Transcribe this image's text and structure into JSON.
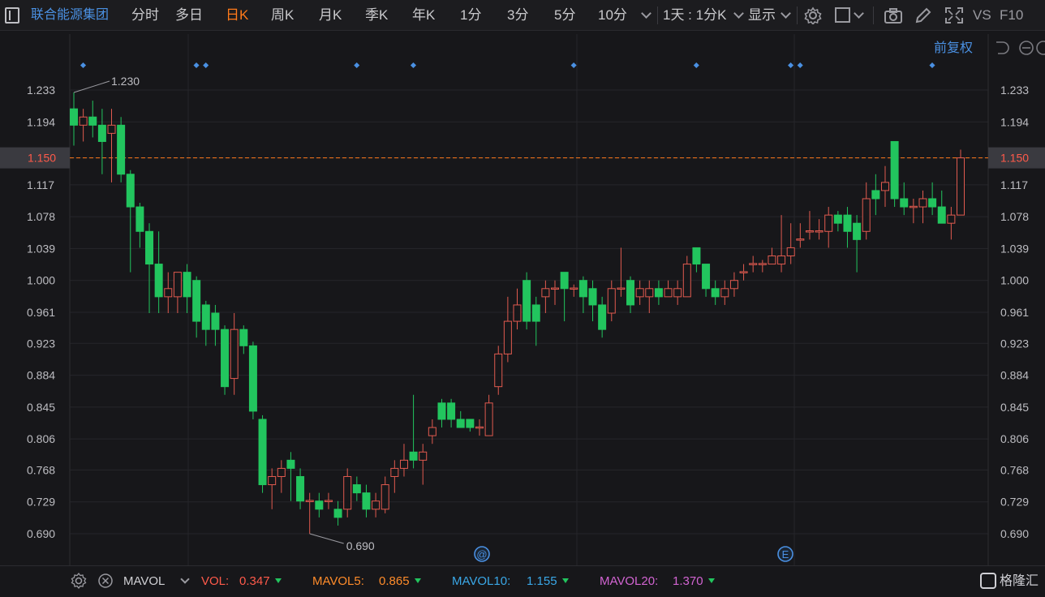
{
  "toolbar": {
    "stock_name": "联合能源集团",
    "periods": [
      "分时",
      "多日",
      "日K",
      "周K",
      "月K",
      "季K",
      "年K",
      "1分",
      "3分",
      "5分",
      "10分"
    ],
    "active_period": "日K",
    "interval_label": "1天 : 1分K",
    "display_label": "显示",
    "vs_label": "VS",
    "f10_label": "F10"
  },
  "chart_header": {
    "adjust_label": "前复权"
  },
  "current_price_label": "1.150",
  "colors": {
    "up": "#e05a4f",
    "down": "#22c55e",
    "accent_orange": "#ff7a1a",
    "link_blue": "#4a90e2"
  },
  "chart_data": {
    "type": "candlestick",
    "ylim": [
      0.67,
      1.26
    ],
    "y_ticks": [
      "1.233",
      "1.194",
      "1.150",
      "1.117",
      "1.078",
      "1.039",
      "1.000",
      "0.961",
      "0.923",
      "0.884",
      "0.845",
      "0.806",
      "0.768",
      "0.729",
      "0.690"
    ],
    "current_price": 1.15,
    "max_label": "1.230",
    "min_label": "0.690",
    "event_markers": [
      "@",
      "E"
    ],
    "candles": [
      [
        1.21,
        1.19,
        1.23,
        1.165
      ],
      [
        1.19,
        1.2,
        1.21,
        1.17
      ],
      [
        1.2,
        1.19,
        1.22,
        1.175
      ],
      [
        1.19,
        1.17,
        1.21,
        1.13
      ],
      [
        1.18,
        1.19,
        1.21,
        1.12
      ],
      [
        1.19,
        1.13,
        1.2,
        1.12
      ],
      [
        1.13,
        1.09,
        1.135,
        1.01
      ],
      [
        1.09,
        1.06,
        1.095,
        1.04
      ],
      [
        1.06,
        1.02,
        1.07,
        0.96
      ],
      [
        1.02,
        0.98,
        1.06,
        0.96
      ],
      [
        0.98,
        0.99,
        1.01,
        0.96
      ],
      [
        0.98,
        1.01,
        1.01,
        0.96
      ],
      [
        1.01,
        0.98,
        1.02,
        0.96
      ],
      [
        1.0,
        0.95,
        1.005,
        0.93
      ],
      [
        0.97,
        0.94,
        0.975,
        0.92
      ],
      [
        0.96,
        0.94,
        0.97,
        0.92
      ],
      [
        0.94,
        0.87,
        0.945,
        0.86
      ],
      [
        0.88,
        0.94,
        0.96,
        0.86
      ],
      [
        0.94,
        0.92,
        0.945,
        0.91
      ],
      [
        0.92,
        0.84,
        0.925,
        0.83
      ],
      [
        0.83,
        0.75,
        0.835,
        0.74
      ],
      [
        0.75,
        0.76,
        0.77,
        0.72
      ],
      [
        0.76,
        0.77,
        0.78,
        0.74
      ],
      [
        0.78,
        0.77,
        0.79,
        0.73
      ],
      [
        0.76,
        0.73,
        0.77,
        0.72
      ],
      [
        0.73,
        0.73,
        0.74,
        0.69
      ],
      [
        0.73,
        0.72,
        0.74,
        0.71
      ],
      [
        0.73,
        0.73,
        0.74,
        0.72
      ],
      [
        0.72,
        0.71,
        0.73,
        0.7
      ],
      [
        0.72,
        0.76,
        0.77,
        0.71
      ],
      [
        0.75,
        0.74,
        0.76,
        0.73
      ],
      [
        0.74,
        0.72,
        0.75,
        0.71
      ],
      [
        0.72,
        0.73,
        0.74,
        0.71
      ],
      [
        0.72,
        0.75,
        0.76,
        0.715
      ],
      [
        0.76,
        0.77,
        0.78,
        0.74
      ],
      [
        0.77,
        0.78,
        0.8,
        0.76
      ],
      [
        0.79,
        0.78,
        0.86,
        0.77
      ],
      [
        0.78,
        0.79,
        0.8,
        0.75
      ],
      [
        0.81,
        0.82,
        0.83,
        0.8
      ],
      [
        0.85,
        0.83,
        0.855,
        0.82
      ],
      [
        0.85,
        0.83,
        0.855,
        0.82
      ],
      [
        0.83,
        0.82,
        0.84,
        0.82
      ],
      [
        0.83,
        0.82,
        0.83,
        0.815
      ],
      [
        0.82,
        0.82,
        0.83,
        0.81
      ],
      [
        0.81,
        0.85,
        0.86,
        0.81
      ],
      [
        0.87,
        0.91,
        0.92,
        0.86
      ],
      [
        0.91,
        0.95,
        0.98,
        0.9
      ],
      [
        0.95,
        0.97,
        0.99,
        0.94
      ],
      [
        1.0,
        0.95,
        1.01,
        0.94
      ],
      [
        0.97,
        0.95,
        0.98,
        0.92
      ],
      [
        0.98,
        0.99,
        1.0,
        0.96
      ],
      [
        0.99,
        0.99,
        1.0,
        0.97
      ],
      [
        1.01,
        0.99,
        1.01,
        0.95
      ],
      [
        0.99,
        0.99,
        0.995,
        0.98
      ],
      [
        1.0,
        0.98,
        1.005,
        0.96
      ],
      [
        0.99,
        0.97,
        1.0,
        0.95
      ],
      [
        0.97,
        0.94,
        0.98,
        0.93
      ],
      [
        0.96,
        0.99,
        1.0,
        0.95
      ],
      [
        0.99,
        0.99,
        1.04,
        0.98
      ],
      [
        1.0,
        0.97,
        1.005,
        0.96
      ],
      [
        0.98,
        0.99,
        1.0,
        0.97
      ],
      [
        0.98,
        0.99,
        1.0,
        0.96
      ],
      [
        0.99,
        0.98,
        1.0,
        0.97
      ],
      [
        0.98,
        0.99,
        1.0,
        0.98
      ],
      [
        0.98,
        0.99,
        1.0,
        0.97
      ],
      [
        0.98,
        1.02,
        1.03,
        0.98
      ],
      [
        1.04,
        1.02,
        1.04,
        1.01
      ],
      [
        1.02,
        0.99,
        1.02,
        0.98
      ],
      [
        0.99,
        0.98,
        1.0,
        0.97
      ],
      [
        0.98,
        0.99,
        1.0,
        0.97
      ],
      [
        0.99,
        1.0,
        1.01,
        0.98
      ],
      [
        1.01,
        1.01,
        1.02,
        1.0
      ],
      [
        1.02,
        1.02,
        1.03,
        1.01
      ],
      [
        1.02,
        1.02,
        1.025,
        1.01
      ],
      [
        1.02,
        1.03,
        1.04,
        1.02
      ],
      [
        1.02,
        1.03,
        1.08,
        1.01
      ],
      [
        1.03,
        1.04,
        1.07,
        1.02
      ],
      [
        1.05,
        1.05,
        1.07,
        1.04
      ],
      [
        1.06,
        1.06,
        1.085,
        1.05
      ],
      [
        1.06,
        1.06,
        1.075,
        1.05
      ],
      [
        1.06,
        1.08,
        1.09,
        1.04
      ],
      [
        1.08,
        1.07,
        1.085,
        1.06
      ],
      [
        1.08,
        1.06,
        1.09,
        1.04
      ],
      [
        1.07,
        1.05,
        1.08,
        1.01
      ],
      [
        1.06,
        1.1,
        1.12,
        1.05
      ],
      [
        1.11,
        1.1,
        1.13,
        1.08
      ],
      [
        1.11,
        1.12,
        1.14,
        1.09
      ],
      [
        1.17,
        1.1,
        1.17,
        1.09
      ],
      [
        1.1,
        1.09,
        1.12,
        1.08
      ],
      [
        1.09,
        1.09,
        1.1,
        1.07
      ],
      [
        1.09,
        1.1,
        1.11,
        1.07
      ],
      [
        1.1,
        1.09,
        1.12,
        1.08
      ],
      [
        1.09,
        1.07,
        1.11,
        1.07
      ],
      [
        1.07,
        1.08,
        1.09,
        1.05
      ],
      [
        1.08,
        1.15,
        1.16,
        1.08
      ]
    ],
    "indicators": {
      "name": "MAVOL",
      "vol": {
        "label": "VOL:",
        "value": "0.347"
      },
      "mavol5": {
        "label": "MAVOL5:",
        "value": "0.865"
      },
      "mavol10": {
        "label": "MAVOL10:",
        "value": "1.155"
      },
      "mavol20": {
        "label": "MAVOL20:",
        "value": "1.370"
      }
    }
  },
  "watermark": "格隆汇"
}
